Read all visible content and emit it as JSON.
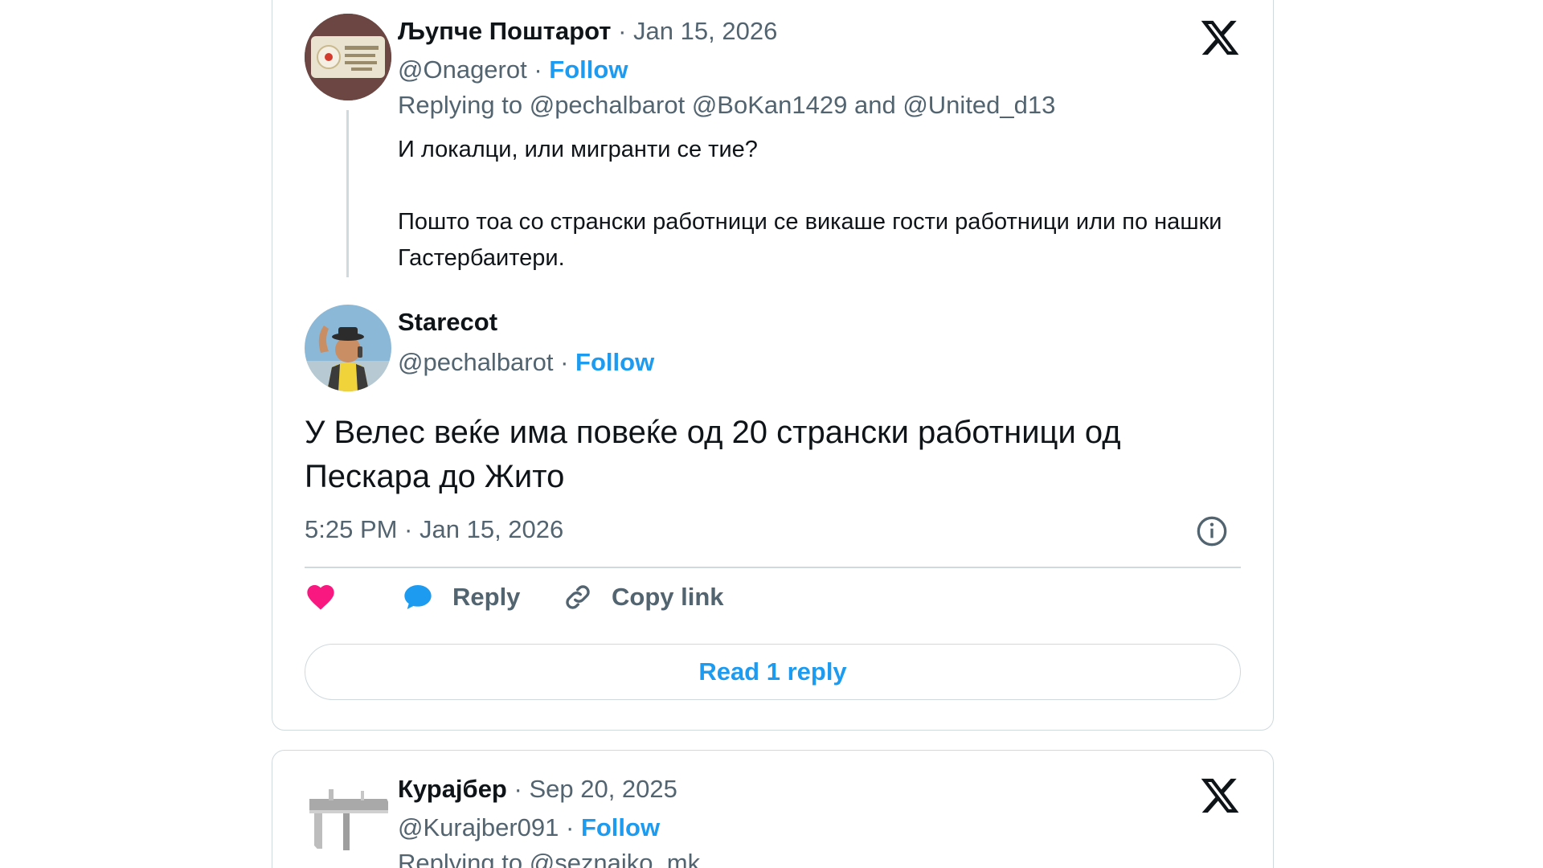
{
  "tweet1": {
    "quoted": {
      "name": "Љупче Поштарот",
      "date": "Jan 15, 2026",
      "handle": "@Onagerot",
      "follow": "Follow",
      "replying_prefix": "Replying to",
      "mention1": "@pechalbarot",
      "mention2": "@BoKan1429",
      "and": "and",
      "mention3": "@United_d13",
      "text_line1": "И локалци, или мигранти се тие?",
      "text_line2": "Пошто тоа со странски работници се викаше гости работници или по нашки Гастербаитери."
    },
    "main": {
      "name": "Starecot",
      "handle": "@pechalbarot",
      "follow": "Follow",
      "text": "У Велес веќе има повеќе од 20 странски работници од Пескара до Жито",
      "timestamp": "5:25 PM · Jan 15, 2026"
    },
    "actions": {
      "reply": "Reply",
      "copy_link": "Copy link"
    },
    "read_replies": "Read 1 reply"
  },
  "tweet2": {
    "name": "Курајбер",
    "date": "Sep 20, 2025",
    "handle": "@Kurajber091",
    "follow": "Follow",
    "replying_prefix": "Replying to",
    "mention1": "@seznaiko_mk"
  },
  "colors": {
    "accent": "#1d9bf0",
    "muted": "#536471",
    "like": "#f91880",
    "border": "#cfd9de"
  },
  "icons": {
    "logo": "x-logo-icon",
    "info": "info-icon",
    "like": "heart-icon",
    "reply": "speech-bubble-icon",
    "copy": "link-icon"
  }
}
